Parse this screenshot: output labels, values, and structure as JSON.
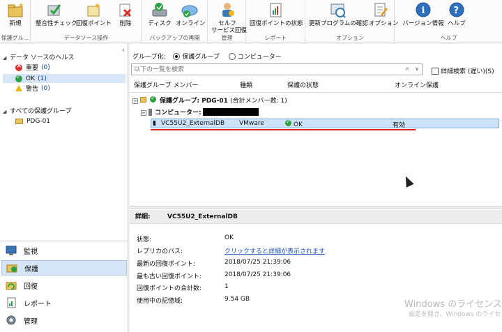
{
  "ribbon": {
    "groups": [
      {
        "label": "保護グル...",
        "buttons": [
          {
            "label": "新規",
            "icon": "new-folder-icon"
          }
        ]
      },
      {
        "label": "データソース操作",
        "buttons": [
          {
            "label": "整合性チェック",
            "icon": "consistency-check-icon"
          },
          {
            "label": "回復ポイント",
            "icon": "recovery-point-icon"
          },
          {
            "label": "削除",
            "icon": "delete-icon"
          }
        ]
      },
      {
        "label": "バックアップの再開",
        "buttons": [
          {
            "label": "ディスク",
            "icon": "disk-icon"
          },
          {
            "label": "オンライン",
            "icon": "online-icon"
          }
        ]
      },
      {
        "label": "管理",
        "buttons": [
          {
            "label": "セルフ",
            "label2": "サービス回復",
            "icon": "self-service-icon"
          }
        ]
      },
      {
        "label": "レポート",
        "buttons": [
          {
            "label": "回復ポイントの状態",
            "icon": "report-icon"
          }
        ]
      },
      {
        "label": "オプション",
        "buttons": [
          {
            "label": "更新プログラムの確認",
            "icon": "update-icon"
          },
          {
            "label": "オプション",
            "icon": "options-icon"
          }
        ]
      },
      {
        "label": "ヘルプ",
        "buttons": [
          {
            "label": "バージョン情報",
            "icon": "info-icon"
          },
          {
            "label": "ヘルプ",
            "icon": "help-icon"
          }
        ]
      }
    ]
  },
  "nav": {
    "health_header": "データ ソースのヘルス",
    "health_items": [
      {
        "label": "重要",
        "count": "(0)",
        "status": "critical"
      },
      {
        "label": "OK",
        "count": "(1)",
        "status": "ok"
      },
      {
        "label": "警告",
        "count": "(0)",
        "status": "warning"
      }
    ],
    "groups_header": "すべての保護グループ",
    "group_items": [
      {
        "label": "PDG-01"
      }
    ],
    "sections": [
      {
        "label": "監視",
        "icon": "monitor-icon",
        "selected": false
      },
      {
        "label": "保護",
        "icon": "protection-icon",
        "selected": true
      },
      {
        "label": "回復",
        "icon": "recovery-icon",
        "selected": false
      },
      {
        "label": "レポート",
        "icon": "reports-icon",
        "selected": false
      },
      {
        "label": "管理",
        "icon": "management-icon",
        "selected": false
      }
    ]
  },
  "main": {
    "group_by_label": "グループ化:",
    "radio_group": "保護グループ",
    "radio_computer": "コンピューター",
    "search_placeholder": "以下の一覧を検索",
    "detailed_search": "詳細検索 (遅い)(S)",
    "columns": [
      "保護グループ メンバー",
      "種類",
      "保護の状態",
      "オンライン保護"
    ],
    "group_row": "保護グループ: PDG-01",
    "group_row_meta": "(合計メンバー数: 1)",
    "computer_row": "コンピューター:",
    "member": {
      "name": "VC55U2_ExternalDB",
      "type": "VMware",
      "status": "OK",
      "online": "有効"
    }
  },
  "details": {
    "header_label": "詳細:",
    "header_name": "VC55U2_ExternalDB",
    "rows": [
      {
        "label": "状態:",
        "value": "OK"
      },
      {
        "label": "レプリカのパス:",
        "value": "クリックすると詳細が表示されます",
        "link": true
      },
      {
        "label": "最新の回復ポイント:",
        "value": "2018/07/25 21:39:06"
      },
      {
        "label": "最も古い回復ポイント:",
        "value": "2018/07/25 21:39:06"
      },
      {
        "label": "回復ポイントの合計数:",
        "value": "1"
      },
      {
        "label": "使用中の記憶域:",
        "value": "9.54 GB"
      }
    ]
  },
  "watermark": {
    "line1": "Windows のライセンス認",
    "line2": "設定を開き、Windows のライセ"
  },
  "colors": {
    "accent": "#cde3fa",
    "selection": "#d6e6f7",
    "highlight_line": "#e01f1f",
    "ok": "#2ea043",
    "critical": "#d8302a",
    "warning": "#f1b51c"
  }
}
